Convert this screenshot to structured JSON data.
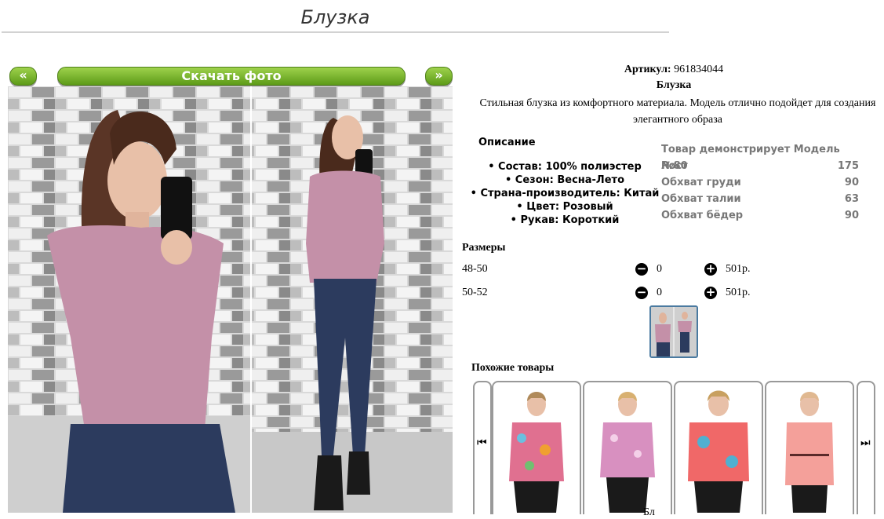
{
  "page": {
    "title": "Блузка"
  },
  "gallery": {
    "prev": "«",
    "next": "»",
    "download": "Скачать фото"
  },
  "product": {
    "article_label": "Артикул:",
    "article_value": "961834044",
    "name": "Блузка",
    "description": "Стильная блузка из комфортного материала. Модель отлично подойдет для создания элегантного образа"
  },
  "description": {
    "title": "Описание",
    "items": [
      "• Состав: 100% полиэстер",
      "• Сезон: Весна-Лето",
      "• Страна-производитель: Китай",
      "• Цвет: Розовый",
      "• Рукав: Короткий"
    ]
  },
  "model": {
    "header": "Товар демонстрирует Модель №80",
    "rows": [
      {
        "label": "Рост",
        "value": "175"
      },
      {
        "label": "Обхват груди",
        "value": "90"
      },
      {
        "label": "Обхват талии",
        "value": "63"
      },
      {
        "label": "Обхват бёдер",
        "value": "90"
      }
    ]
  },
  "sizes": {
    "title": "Размеры",
    "rows": [
      {
        "size": "48-50",
        "qty": "0",
        "price": "501р."
      },
      {
        "size": "50-52",
        "qty": "0",
        "price": "501р."
      }
    ]
  },
  "similar": {
    "title": "Похожие товары",
    "bottom_text": "Бл"
  },
  "icons": {
    "minus": "minus-circle-icon",
    "plus": "plus-circle-icon",
    "prev": "skip-prev-icon",
    "next": "skip-next-icon"
  },
  "colors": {
    "button_green": "#6fae24",
    "thumb_border": "#4a7aa0",
    "blouse_pink": "#c490a8"
  }
}
